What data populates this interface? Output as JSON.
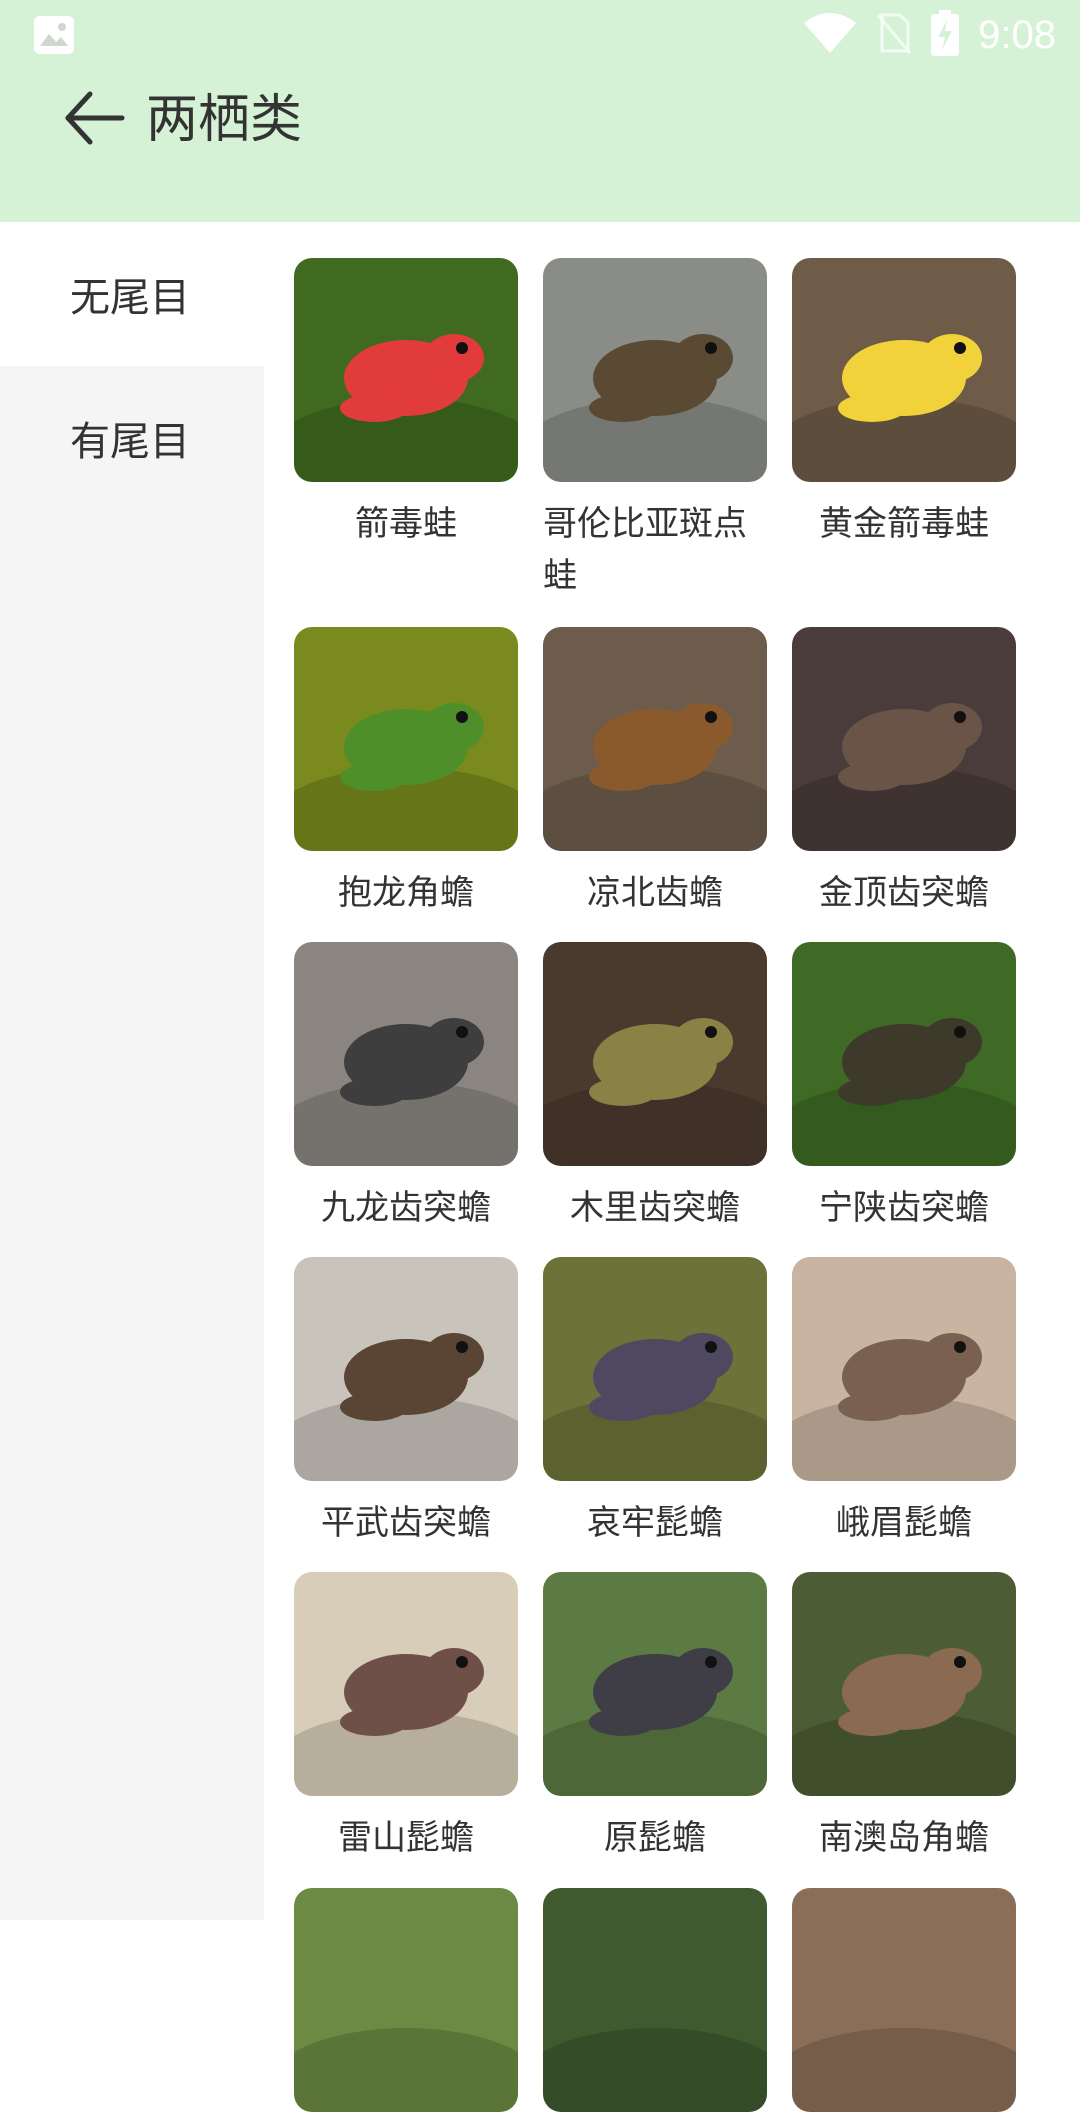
{
  "status_bar": {
    "time": "9:08",
    "icons": [
      "image-icon",
      "wifi-icon",
      "no-sim-icon",
      "battery-charging-icon"
    ]
  },
  "app_bar": {
    "title": "两栖类",
    "back_icon": "back-arrow-icon"
  },
  "sidebar": {
    "items": [
      {
        "label": "无尾目",
        "selected": true
      },
      {
        "label": "有尾目",
        "selected": false
      }
    ]
  },
  "grid": {
    "items": [
      {
        "name": "箭毒蛙",
        "bg": "#3f6a1f",
        "frog": "#e23b3b"
      },
      {
        "name": "哥伦比亚斑点蛙",
        "bg": "#8a8c88",
        "frog": "#5a4a34"
      },
      {
        "name": "黄金箭毒蛙",
        "bg": "#6e5b48",
        "frog": "#f2d23a"
      },
      {
        "name": "抱龙角蟾",
        "bg": "#7a8a1e",
        "frog": "#4f8f2a"
      },
      {
        "name": "凉北齿蟾",
        "bg": "#6d5c4c",
        "frog": "#8a5a2c"
      },
      {
        "name": "金顶齿突蟾",
        "bg": "#4a3c3a",
        "frog": "#6a5448"
      },
      {
        "name": "九龙齿突蟾",
        "bg": "#8a8580",
        "frog": "#3e3e3e"
      },
      {
        "name": "木里齿突蟾",
        "bg": "#4a3a2e",
        "frog": "#8a8244"
      },
      {
        "name": "宁陕齿突蟾",
        "bg": "#3f6a26",
        "frog": "#3d3a2c"
      },
      {
        "name": "平武齿突蟾",
        "bg": "#c9c4bb",
        "frog": "#5a4434"
      },
      {
        "name": "哀牢髭蟾",
        "bg": "#6c7238",
        "frog": "#4e4860"
      },
      {
        "name": "峨眉髭蟾",
        "bg": "#c8b4a0",
        "frog": "#7a6050"
      },
      {
        "name": "雷山髭蟾",
        "bg": "#d8cdb8",
        "frog": "#6e5048"
      },
      {
        "name": "原髭蟾",
        "bg": "#5c7a44",
        "frog": "#3f3d46"
      },
      {
        "name": "南澳岛角蟾",
        "bg": "#4c5c34",
        "frog": "#8a6a50"
      },
      {
        "name": "",
        "bg": "#6c8a44",
        "frog": "#6c8a44"
      },
      {
        "name": "",
        "bg": "#3e5a2e",
        "frog": "#3e5a2e"
      },
      {
        "name": "",
        "bg": "#8a6e58",
        "frog": "#8a6e58"
      }
    ]
  }
}
